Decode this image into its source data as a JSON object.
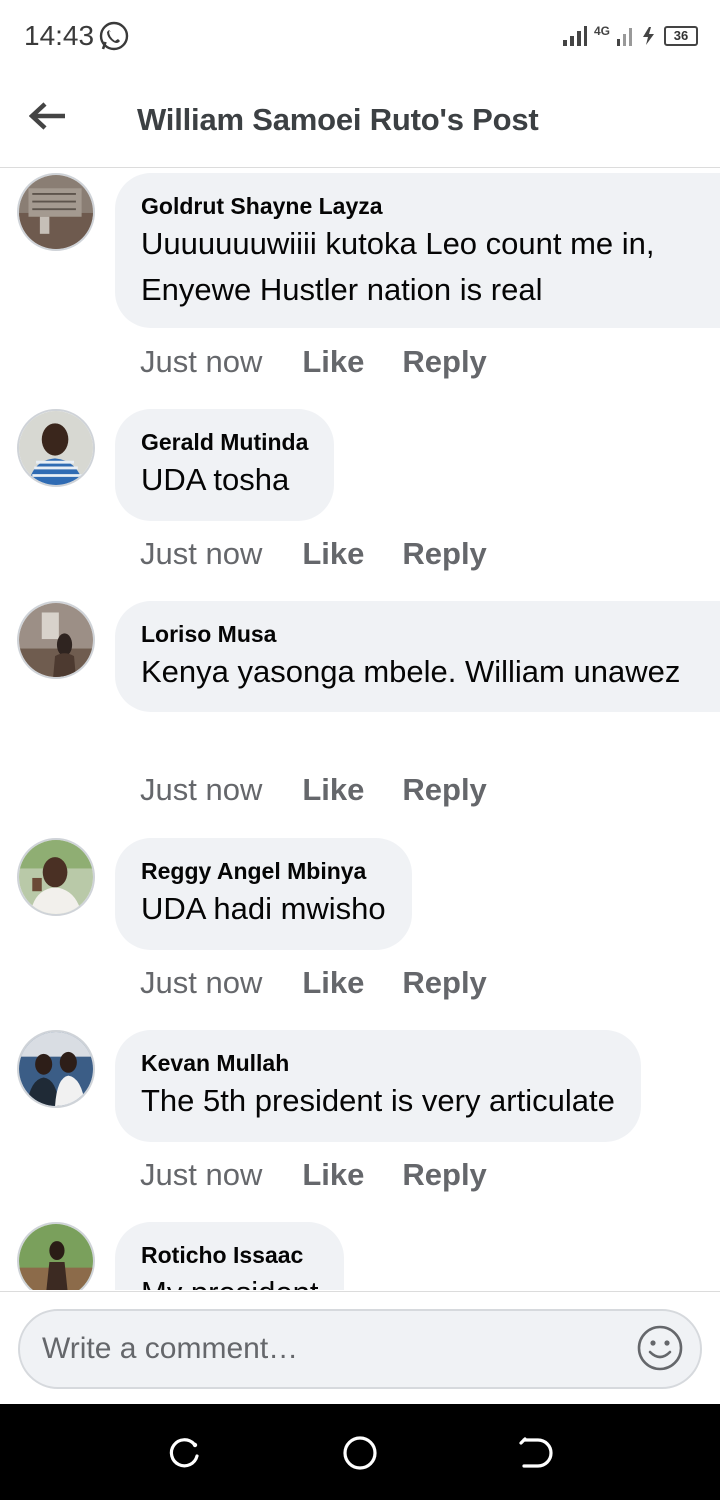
{
  "status": {
    "time": "14:43",
    "network": "4G",
    "battery": "36"
  },
  "header": {
    "title": "William Samoei Ruto's Post"
  },
  "comments": [
    {
      "author": "Goldrut Shayne Layza",
      "text": "Uuuuuuuwiiii kutoka Leo count me in, Enyewe Hustler nation is real",
      "time": "Just now",
      "like": "Like",
      "reply": "Reply"
    },
    {
      "author": "Gerald Mutinda",
      "text": "UDA tosha",
      "time": "Just now",
      "like": "Like",
      "reply": "Reply"
    },
    {
      "author": "Loriso Musa",
      "text": "Kenya yasonga mbele. William unawez",
      "time": "Just now",
      "like": "Like",
      "reply": "Reply"
    },
    {
      "author": "Reggy Angel Mbinya",
      "text": "UDA hadi mwisho",
      "time": "Just now",
      "like": "Like",
      "reply": "Reply"
    },
    {
      "author": "Kevan Mullah",
      "text": "The 5th president is very articulate",
      "time": "Just now",
      "like": "Like",
      "reply": "Reply"
    },
    {
      "author": "Roticho Issaac",
      "text": "My president"
    }
  ],
  "composer": {
    "placeholder": "Write a comment…"
  },
  "icons": {
    "back": "arrow-left-icon",
    "emoji": "smiley-icon",
    "whatsapp": "whatsapp-icon"
  },
  "colors": {
    "bubble": "#f0f2f5",
    "meta": "#65676b",
    "title": "#3c4043"
  }
}
